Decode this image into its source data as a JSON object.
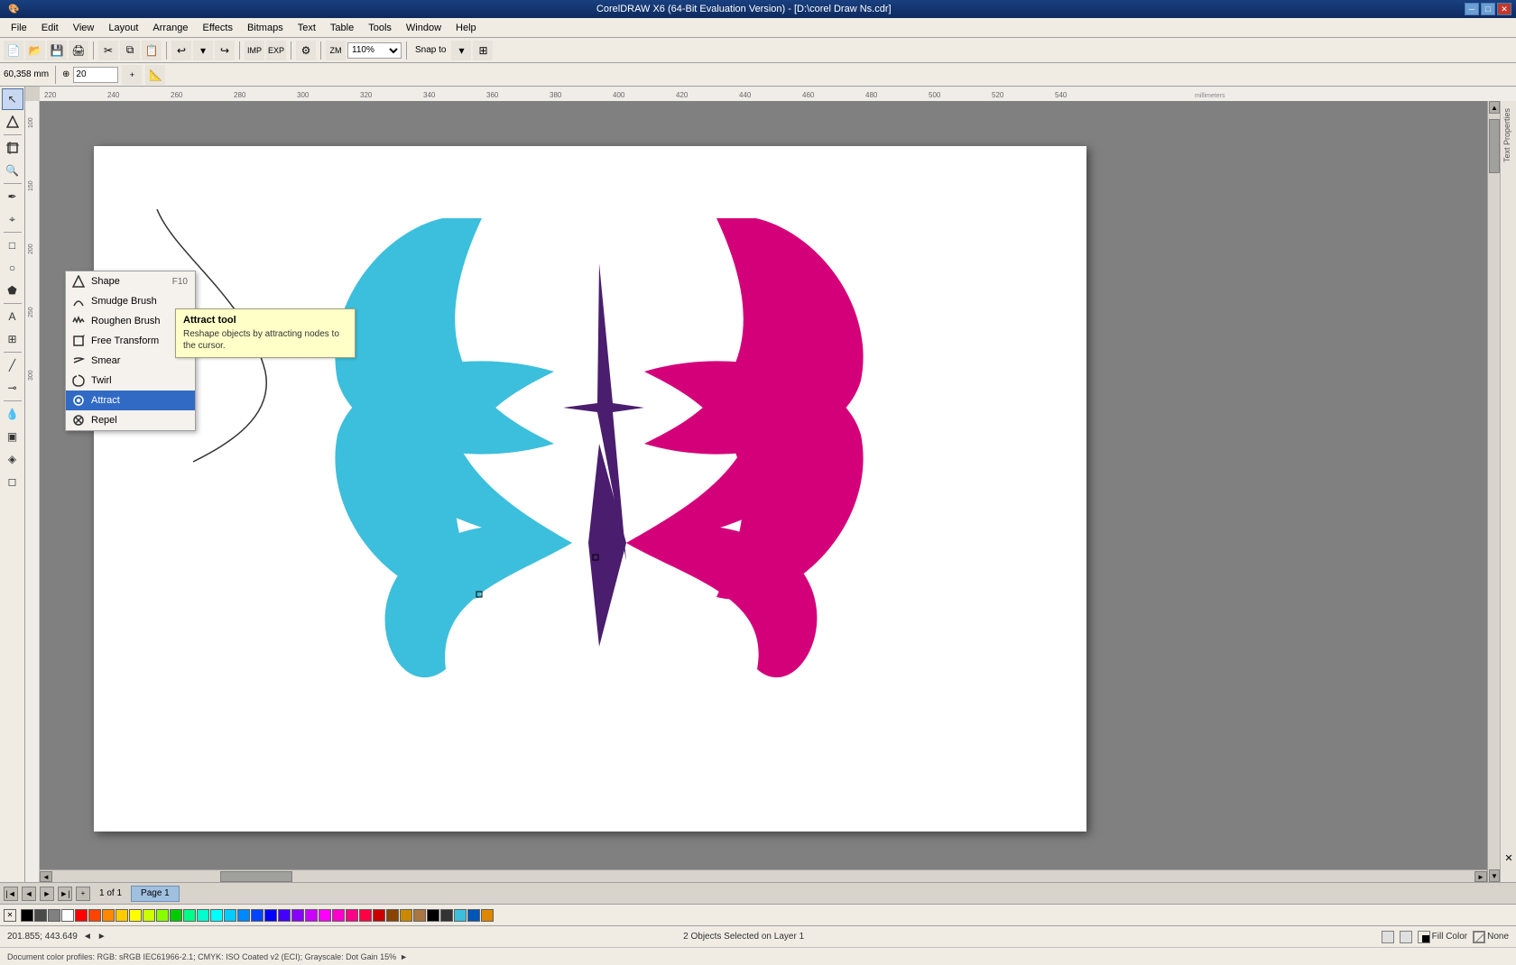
{
  "window": {
    "title": "CorelDRAW X6 (64-Bit Evaluation Version) - [D:\\corel Draw Ns.cdr]",
    "titlebar_icons": [
      "minimize",
      "maximize",
      "close"
    ]
  },
  "menubar": {
    "items": [
      "File",
      "Edit",
      "View",
      "Layout",
      "Arrange",
      "Effects",
      "Bitmaps",
      "Text",
      "Table",
      "Tools",
      "Window",
      "Help"
    ]
  },
  "toolbar": {
    "tools": [
      "new",
      "open",
      "save",
      "print",
      "cut",
      "copy",
      "paste",
      "undo",
      "redo",
      "import",
      "export",
      "zoom-in",
      "zoom-out"
    ]
  },
  "toolbar2": {
    "coords": "60,358 mm",
    "size": "20",
    "zoom": "110%",
    "snap": "Snap to"
  },
  "left_tools": {
    "items": [
      {
        "name": "pick",
        "icon": "↖",
        "label": "Pick Tool"
      },
      {
        "name": "shape",
        "icon": "⬡",
        "label": "Shape Tool"
      },
      {
        "name": "smudge",
        "icon": "✏",
        "label": "Smudge Brush"
      },
      {
        "name": "roughen",
        "icon": "~",
        "label": "Roughen Brush"
      },
      {
        "name": "free-transform",
        "icon": "⟳",
        "label": "Free Transform"
      },
      {
        "name": "smear-tool",
        "icon": "≋",
        "label": "Smear"
      },
      {
        "name": "crop",
        "icon": "⊡",
        "label": "Crop Tool"
      },
      {
        "name": "zoom",
        "icon": "🔍",
        "label": "Zoom Tool"
      },
      {
        "name": "freehand",
        "icon": "✒",
        "label": "Freehand Tool"
      },
      {
        "name": "smart-draw",
        "icon": "⌖",
        "label": "Smart Drawing"
      },
      {
        "name": "rectangle",
        "icon": "□",
        "label": "Rectangle Tool"
      },
      {
        "name": "ellipse",
        "icon": "○",
        "label": "Ellipse Tool"
      },
      {
        "name": "polygon",
        "icon": "⬟",
        "label": "Polygon Tool"
      },
      {
        "name": "text",
        "icon": "A",
        "label": "Text Tool"
      },
      {
        "name": "table",
        "icon": "⊞",
        "label": "Table Tool"
      },
      {
        "name": "parallel",
        "icon": "∥",
        "label": "Parallel Dimension"
      },
      {
        "name": "straight",
        "icon": "╱",
        "label": "Straight Line"
      },
      {
        "name": "connector",
        "icon": "⊸",
        "label": "Connector Tool"
      },
      {
        "name": "dropper",
        "icon": "◫",
        "label": "Dropper"
      },
      {
        "name": "fill",
        "icon": "▣",
        "label": "Interactive Fill"
      },
      {
        "name": "smart-fill",
        "icon": "◈",
        "label": "Smart Fill"
      },
      {
        "name": "transparency",
        "icon": "◻",
        "label": "Transparency Tool"
      }
    ]
  },
  "context_menu": {
    "title": "Shape tools flyout",
    "items": [
      {
        "name": "shape",
        "label": "Shape",
        "shortcut": "F10",
        "icon": "⬡",
        "active": false
      },
      {
        "name": "smudge-brush",
        "label": "Smudge Brush",
        "shortcut": "",
        "icon": "✏",
        "active": false
      },
      {
        "name": "roughen-brush",
        "label": "Roughen Brush",
        "shortcut": "",
        "icon": "~",
        "active": false
      },
      {
        "name": "free-transform",
        "label": "Free Transform",
        "shortcut": "",
        "icon": "⟳",
        "active": false
      },
      {
        "name": "smear",
        "label": "Smear",
        "shortcut": "",
        "icon": "≋",
        "active": false
      },
      {
        "name": "twirl",
        "label": "Twirl",
        "shortcut": "",
        "icon": "⟐",
        "active": false
      },
      {
        "name": "attract",
        "label": "Attract",
        "shortcut": "",
        "icon": "◎",
        "active": true
      },
      {
        "name": "repel",
        "label": "Repel",
        "shortcut": "",
        "icon": "◉",
        "active": false
      }
    ]
  },
  "tooltip": {
    "title": "Attract tool",
    "description": "Reshape objects by attracting nodes to the cursor."
  },
  "canvas": {
    "zoom": "110%",
    "page": "1 of 1",
    "current_page": "Page 1"
  },
  "statusbar": {
    "coords": "201.855; 443.649",
    "status": "2 Objects Selected on Layer 1",
    "fill_label": "Fill Color",
    "fill_color": "None",
    "profile": "Document color profiles: RGB: sRGB IEC61966-2.1; CMYK: ISO Coated v2 (ECI); Grayscale: Dot Gain 15%"
  },
  "colors": {
    "cyan_shape": "#3cbfdc",
    "magenta_shape": "#d4007a",
    "purple_shape": "#4a1d6e",
    "palette_swatches": [
      "#000000",
      "#4a4a4a",
      "#808080",
      "#ffffff",
      "#ff0000",
      "#ff4400",
      "#ff8800",
      "#ffcc00",
      "#ffff00",
      "#ccff00",
      "#88ff00",
      "#44ff00",
      "#00ff00",
      "#00ff44",
      "#00ff88",
      "#00ffcc",
      "#00ffff",
      "#00ccff",
      "#0088ff",
      "#0044ff",
      "#0000ff",
      "#4400ff",
      "#8800ff",
      "#cc00ff",
      "#ff00ff",
      "#ff00cc",
      "#ff0088",
      "#ff0044",
      "#cc0000",
      "#880000",
      "#440000",
      "#008800",
      "#004400",
      "#000088",
      "#000044",
      "#884400",
      "#cc8800",
      "#aa5500",
      "#663300",
      "#330000"
    ]
  }
}
